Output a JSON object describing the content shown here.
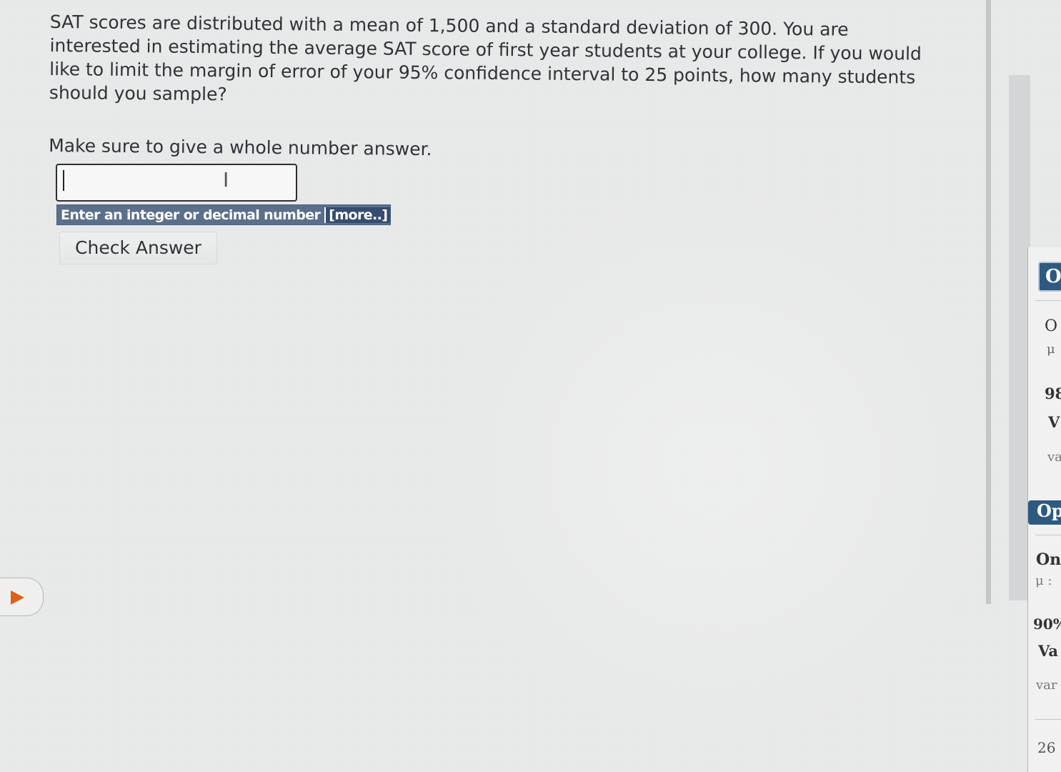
{
  "question": {
    "text": "SAT scores are distributed with a mean of 1,500 and a standard deviation of 300. You are interested in estimating the average SAT score of first year students at your college. If you would like to limit the margin of error of your 95% confidence interval to 25 points, how many students should you sample?",
    "instruction": "Make sure to give a whole number answer."
  },
  "answer": {
    "value": "",
    "placeholder": "",
    "hint": "Enter an integer or decimal number",
    "hint_more": "[more..]"
  },
  "buttons": {
    "check_answer": "Check Answer"
  },
  "side_panel": {
    "items": [
      {
        "text": "O"
      },
      {
        "text": "O"
      },
      {
        "text": "μ"
      },
      {
        "text": "98"
      },
      {
        "text": "V"
      },
      {
        "text": "va"
      },
      {
        "text": "Op"
      },
      {
        "text": "On"
      },
      {
        "text": "μ : "
      },
      {
        "text": "90%"
      },
      {
        "text": "Va"
      },
      {
        "text": "var"
      },
      {
        "text": "26"
      }
    ]
  },
  "colors": {
    "panel_button": "#2d5a80",
    "hint_bg": "#5b6f8b",
    "arrow": "#e05f18"
  },
  "icons": {
    "text_cursor": "text-cursor-icon",
    "expand_arrow": "play-arrow-icon"
  }
}
